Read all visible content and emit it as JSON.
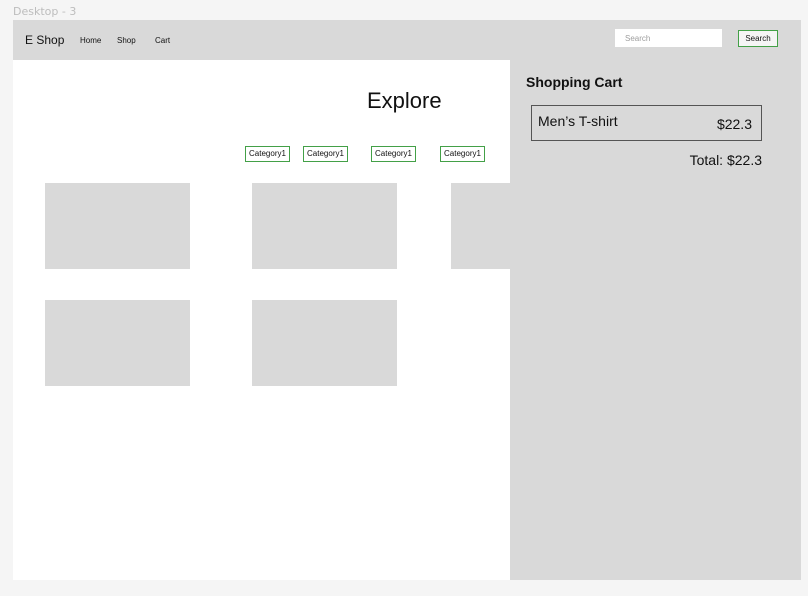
{
  "frame": {
    "label": "Desktop - 3"
  },
  "header": {
    "brand": "E Shop",
    "nav": [
      {
        "label": "Home"
      },
      {
        "label": "Shop"
      },
      {
        "label": "Cart"
      }
    ],
    "search": {
      "placeholder": "Search",
      "value": "",
      "button_label": "Search"
    }
  },
  "main": {
    "title": "Explore",
    "categories": [
      {
        "label": "Category1"
      },
      {
        "label": "Category1"
      },
      {
        "label": "Category1"
      },
      {
        "label": "Category1"
      }
    ]
  },
  "cart": {
    "title": "Shopping Cart",
    "items": [
      {
        "name": "Men’s T-shirt",
        "price": "$22.3"
      }
    ],
    "total": "Total: $22.3"
  },
  "colors": {
    "panel_gray": "#d9d9d9",
    "accent_green": "#43a047",
    "background": "#f5f5f5"
  }
}
